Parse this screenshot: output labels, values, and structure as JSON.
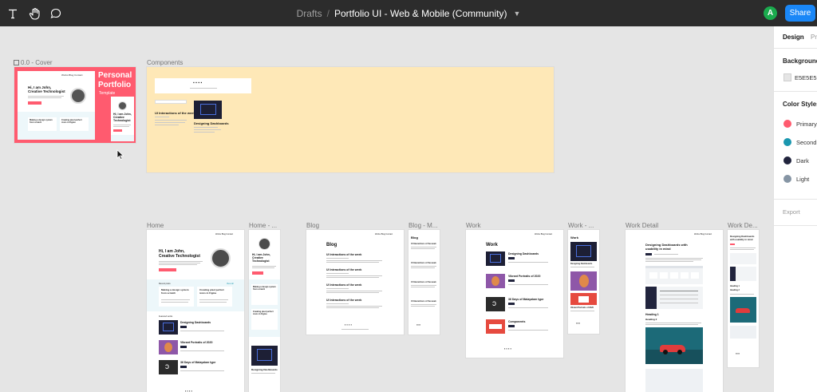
{
  "toolbar": {
    "breadcrumb": "Drafts",
    "separator": "/",
    "file_name": "Portfolio UI - Web & Mobile (Community)",
    "avatar_initial": "A",
    "share_label": "Share"
  },
  "canvas": {
    "background": "#E5E5E5",
    "frames": {
      "cover": "0.0 - Cover",
      "components": "Components",
      "home": "Home",
      "home_mobile": "Home - ...",
      "blog": "Blog",
      "blog_mobile": "Blog - M...",
      "work": "Work",
      "work_mobile": "Work - ...",
      "work_detail": "Work Detail",
      "work_detail_mobile": "Work De..."
    },
    "cover": {
      "hero_line1": "Hi, I am John,",
      "hero_line2": "Creative Technologist",
      "side_title_1": "Personal",
      "side_title_2": "Portfolio",
      "side_subtitle": "Template",
      "mobile_line1": "Hi, I am John,",
      "mobile_line2": "Creative",
      "mobile_line3": "Technologist",
      "nav_1": "Works",
      "nav_2": "Blog",
      "nav_3": "Contact",
      "card_1": "Making a design system from scratch",
      "card_2": "Creating pixel perfect icons in Figma"
    },
    "components": {
      "post_title": "UI Interactions of the week",
      "work_title": "Designing Dashboards"
    },
    "home": {
      "hero_line1": "Hi, I am John,",
      "hero_line2": "Creative Technologist",
      "recent_posts": "Recent posts",
      "view_all": "View all",
      "card_1": "Making a design system from scratch",
      "card_2": "Creating pixel perfect icons in Figma",
      "featured": "Featured works",
      "work_1": "Designing Dashboards",
      "work_2": "Vibrant Portraits of 2020",
      "work_3": "36 Days of Malayalam type"
    },
    "home_mobile": {
      "line1": "Hi, I am John,",
      "line2": "Creative",
      "line3": "Technologist",
      "card_1": "Making a design system from scratch",
      "card_2": "Creating pixel perfect icons in Figma",
      "work_1": "Designing Dashboards"
    },
    "blog": {
      "title": "Blog",
      "post_1": "UI Interactions of the week",
      "post_2": "UI Interactions of the week",
      "post_3": "UI Interactions of the week",
      "post_4": "UI Interactions of the week"
    },
    "blog_mobile": {
      "title": "Blog",
      "post_1": "UI Interactions of the week",
      "post_2": "UI Interactions of the week",
      "post_3": "UI Interactions of the week",
      "post_4": "UI Interactions of the week"
    },
    "work": {
      "title": "Work",
      "item_1": "Designing Dashboards",
      "item_2": "Vibrant Portraits of 2020",
      "item_3": "36 Days of Malayalam type",
      "item_4": "Components"
    },
    "work_mobile": {
      "title": "Work",
      "item_1": "Designing Dashboards",
      "item_2": "Vibrant Portraits of 2020"
    },
    "work_detail": {
      "title_1": "Designing Dashboards with",
      "title_2": "usability in mind",
      "heading_1": "Heading 1",
      "heading_2": "Heading 2"
    },
    "work_detail_mobile": {
      "title_1": "Designing Dashboards",
      "title_2": "with usability in mind",
      "heading_1": "Heading 1",
      "heading_2": "Heading 2"
    }
  },
  "panel": {
    "tab_design": "Design",
    "tab_prototype": "Pr",
    "background_title": "Background",
    "background_value": "E5E5E5",
    "color_styles_title": "Color Styles",
    "colors": [
      {
        "name": "Primary",
        "hex": "#FF5B6F"
      },
      {
        "name": "Second",
        "hex": "#1A97AF"
      },
      {
        "name": "Dark",
        "hex": "#21243D"
      },
      {
        "name": "Light",
        "hex": "#8695A4"
      }
    ],
    "export_title": "Export"
  },
  "icons": [
    "text-tool-icon",
    "hand-tool-icon",
    "comment-tool-icon",
    "frame-icon",
    "cursor-icon",
    "social-icon"
  ]
}
